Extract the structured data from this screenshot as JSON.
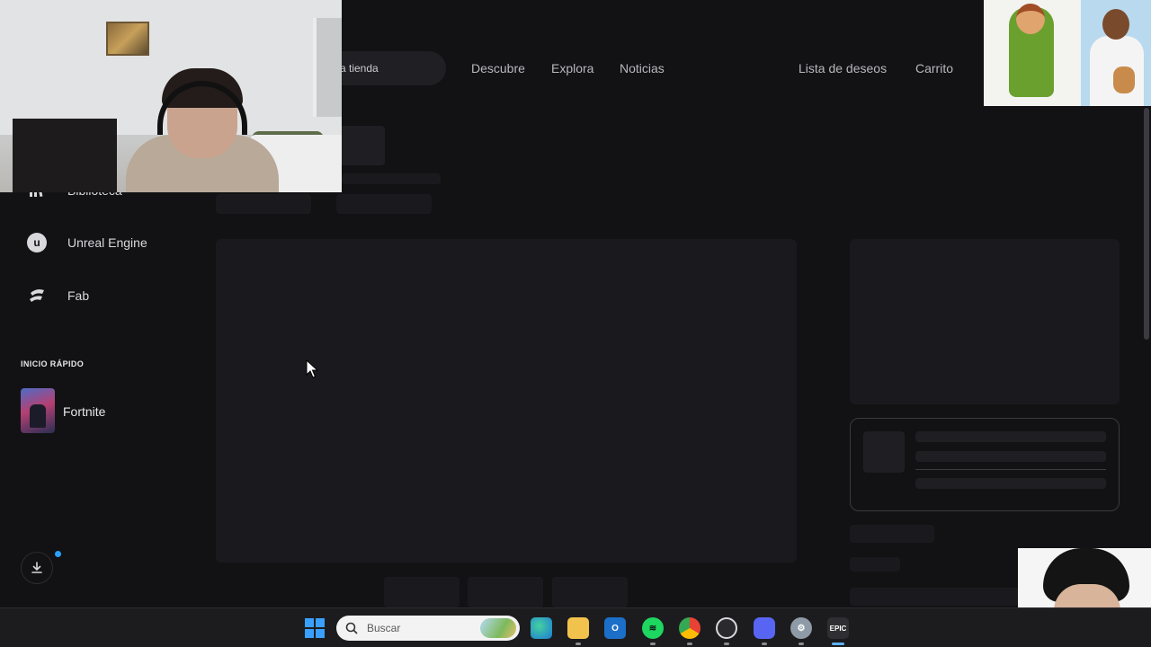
{
  "topbar": {
    "search_label": "a tienda",
    "nav": [
      "Descubre",
      "Explora",
      "Noticias"
    ],
    "wishlist": "Lista de deseos",
    "cart": "Carrito"
  },
  "sidebar": {
    "partial_item": "Biblioteca",
    "items": [
      {
        "label": "Unreal Engine",
        "icon": "unreal-engine-icon"
      },
      {
        "label": "Fab",
        "icon": "fab-icon"
      }
    ],
    "quick_launch_title": "INICIO RÁPIDO",
    "quick_launch": [
      {
        "label": "Fortnite"
      }
    ]
  },
  "taskbar": {
    "search_placeholder": "Buscar",
    "apps": [
      "edge",
      "file-explorer",
      "outlook",
      "spotify",
      "chrome",
      "obs",
      "discord",
      "settings",
      "epic-games"
    ],
    "epic_label": "EPIC"
  },
  "colors": {
    "background": "#121215",
    "text_muted": "#b7b7bd",
    "accent_blue": "#2aa1ff"
  }
}
